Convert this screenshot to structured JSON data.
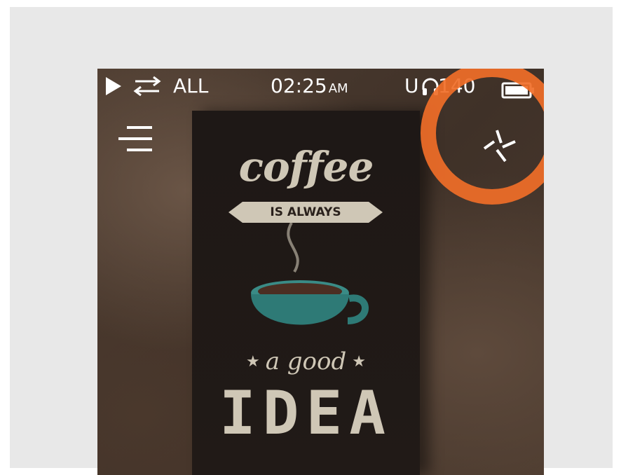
{
  "statusbar": {
    "play_icon": "play-icon",
    "repeat_icon": "repeat-icon",
    "repeat_mode": "ALL",
    "time": "02:25",
    "ampm": "AM",
    "usb_label": "U",
    "headphone_icon": "headphone-icon",
    "volume": "140",
    "battery_icon": "battery-icon"
  },
  "toolbar": {
    "menu_icon": "menu-icon",
    "shuffle_icon": "shuffle-icon"
  },
  "album_art": {
    "title": "coffee",
    "ribbon": "IS ALWAYS",
    "line2": "a good",
    "line3": "IDEA",
    "star": "★"
  },
  "colors": {
    "highlight": "#f06e28",
    "poster_text": "#cfc7b6",
    "cup": "#2e7a76"
  }
}
